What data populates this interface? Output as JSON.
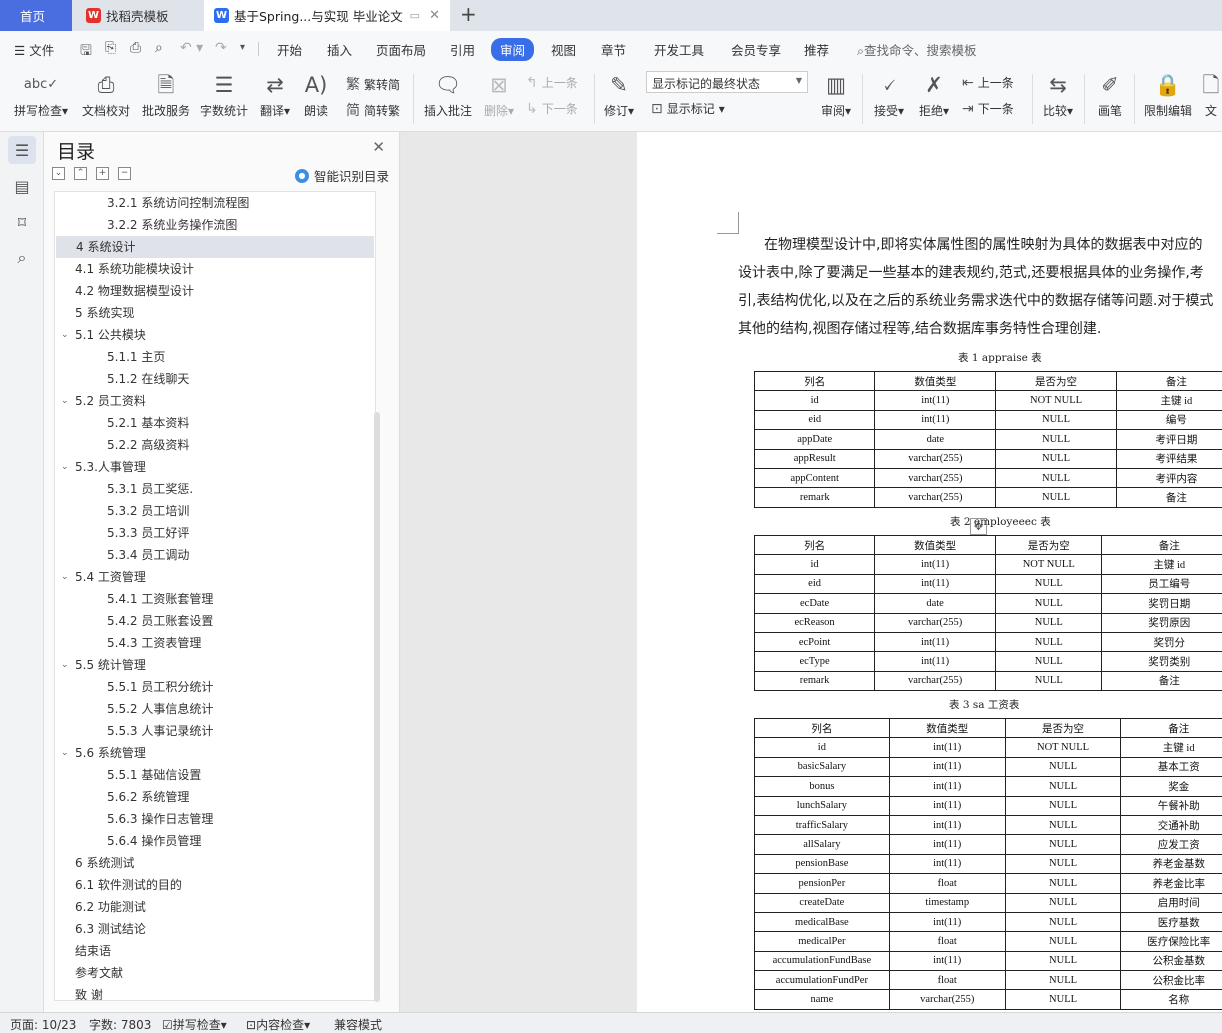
{
  "tabs": {
    "home": "首页",
    "wps": "找稻壳模板",
    "doc": "基于Spring...与实现 毕业论文"
  },
  "menu": {
    "file": "文件",
    "items": [
      "开始",
      "插入",
      "页面布局",
      "引用",
      "审阅",
      "视图",
      "章节",
      "开发工具",
      "会员专享",
      "推荐"
    ],
    "active": "审阅",
    "search": "查找命令、搜索模板"
  },
  "ribbon": {
    "spell": "拼写检查",
    "doccheck": "文档校对",
    "batch": "批改服务",
    "wordcount": "字数统计",
    "translate": "翻译",
    "read": "朗读",
    "trad": "繁转简",
    "simp": "简转繁",
    "insert_comment": "插入批注",
    "delete": "删除",
    "prev1": "上一条",
    "next1": "下一条",
    "track": "修订",
    "display_mode": "显示标记的最终状态",
    "show_marks": "显示标记",
    "review": "审阅",
    "accept": "接受",
    "reject": "拒绝",
    "prev2": "上一条",
    "next2": "下一条",
    "compare": "比较",
    "pen": "画笔",
    "restrict": "限制编辑",
    "doc_partial": "文"
  },
  "toc": {
    "title": "目录",
    "smart": "智能识别目录",
    "items": [
      {
        "label": "3.2.1 系统访问控制流程图",
        "level": 3
      },
      {
        "label": "3.2.2 系统业务操作流图",
        "level": 3
      },
      {
        "label": "4 系统设计",
        "level": 1,
        "selected": true
      },
      {
        "label": "4.1 系统功能模块设计",
        "level": 1
      },
      {
        "label": "4.2 物理数据模型设计",
        "level": 1
      },
      {
        "label": "5 系统实现",
        "level": 1
      },
      {
        "label": "5.1  公共模块",
        "level": 1,
        "expand": true
      },
      {
        "label": "5.1.1 主页",
        "level": 3
      },
      {
        "label": "5.1.2 在线聊天",
        "level": 3
      },
      {
        "label": "5.2  员工资料",
        "level": 1,
        "expand": true
      },
      {
        "label": "5.2.1 基本资料",
        "level": 3
      },
      {
        "label": "5.2.2  高级资料",
        "level": 3
      },
      {
        "label": "5.3.人事管理",
        "level": 1,
        "expand": true
      },
      {
        "label": "5.3.1 员工奖惩.",
        "level": 3
      },
      {
        "label": "5.3.2 员工培训",
        "level": 3
      },
      {
        "label": "5.3.3 员工好评",
        "level": 3
      },
      {
        "label": "5.3.4 员工调动",
        "level": 3
      },
      {
        "label": "5.4 工资管理",
        "level": 1,
        "expand": true
      },
      {
        "label": "5.4.1 工资账套管理",
        "level": 3
      },
      {
        "label": "5.4.2 员工账套设置",
        "level": 3
      },
      {
        "label": "5.4.3 工资表管理",
        "level": 3
      },
      {
        "label": "5.5 统计管理",
        "level": 1,
        "expand": true
      },
      {
        "label": "5.5.1 员工积分统计",
        "level": 3
      },
      {
        "label": "5.5.2 人事信息统计",
        "level": 3
      },
      {
        "label": "5.5.3 人事记录统计",
        "level": 3
      },
      {
        "label": "5.6 系统管理",
        "level": 1,
        "expand": true
      },
      {
        "label": "5.5.1 基础信设置",
        "level": 3
      },
      {
        "label": "5.6.2 系统管理",
        "level": 3
      },
      {
        "label": "5.6.3 操作日志管理",
        "level": 3
      },
      {
        "label": "5.6.4 操作员管理",
        "level": 3
      },
      {
        "label": "6 系统测试",
        "level": 1
      },
      {
        "label": "6.1  软件测试的目的",
        "level": 1
      },
      {
        "label": "6.2  功能测试",
        "level": 1
      },
      {
        "label": "6.3  测试结论",
        "level": 1
      },
      {
        "label": "结束语",
        "level": 1
      },
      {
        "label": "参考文献",
        "level": 1
      },
      {
        "label": "致    谢",
        "level": 1
      }
    ]
  },
  "doc": {
    "para_lines": [
      "在物理模型设计中,即将实体属性图的属性映射为具体的数据表中对应的",
      "设计表中,除了要满足一些基本的建表规约,范式,还要根据具体的业务操作,考",
      "引,表结构优化,以及在之后的系统业务需求迭代中的数据存储等问题.对于模式",
      "其他的结构,视图存储过程等,结合数据库事务特性合理创建."
    ],
    "table1": {
      "caption": "表 1    appraise 表",
      "rows": [
        [
          "列名",
          "数值类型",
          "是否为空",
          "备注"
        ],
        [
          "id",
          "int(11)",
          "NOT NULL",
          "主键 id"
        ],
        [
          "eid",
          "int(11)",
          "NULL",
          "编号"
        ],
        [
          "appDate",
          "date",
          "NULL",
          "考评日期"
        ],
        [
          "appResult",
          "varchar(255)",
          "NULL",
          "考评结果"
        ],
        [
          "appContent",
          "varchar(255)",
          "NULL",
          "考评内容"
        ],
        [
          "remark",
          "varchar(255)",
          "NULL",
          "备注"
        ]
      ]
    },
    "table2": {
      "caption": "表 2    employeeec 表",
      "rows": [
        [
          "列名",
          "数值类型",
          "是否为空",
          "备注"
        ],
        [
          "id",
          "int(11)",
          "NOT NULL",
          "主键 id"
        ],
        [
          "eid",
          "int(11)",
          "NULL",
          "员工编号"
        ],
        [
          "ecDate",
          "date",
          "NULL",
          "奖罚日期"
        ],
        [
          "ecReason",
          "varchar(255)",
          "NULL",
          "奖罚原因"
        ],
        [
          "ecPoint",
          "int(11)",
          "NULL",
          "奖罚分"
        ],
        [
          "ecType",
          "int(11)",
          "NULL",
          "奖罚类别"
        ],
        [
          "remark",
          "varchar(255)",
          "NULL",
          "备注"
        ]
      ]
    },
    "table3": {
      "caption": "表 3    sa        工资表",
      "rows": [
        [
          "列名",
          "数值类型",
          "是否为空",
          "备注"
        ],
        [
          "id",
          "int(11)",
          "NOT NULL",
          "主键 id"
        ],
        [
          "basicSalary",
          "int(11)",
          "NULL",
          "基本工资"
        ],
        [
          "bonus",
          "int(11)",
          "NULL",
          "奖金"
        ],
        [
          "lunchSalary",
          "int(11)",
          "NULL",
          "午餐补助"
        ],
        [
          "trafficSalary",
          "int(11)",
          "NULL",
          "交通补助"
        ],
        [
          "allSalary",
          "int(11)",
          "NULL",
          "应发工资"
        ],
        [
          "pensionBase",
          "int(11)",
          "NULL",
          "养老金基数"
        ],
        [
          "pensionPer",
          "float",
          "NULL",
          "养老金比率"
        ],
        [
          "createDate",
          "timestamp",
          "NULL",
          "启用时间"
        ],
        [
          "medicalBase",
          "int(11)",
          "NULL",
          "医疗基数"
        ],
        [
          "medicalPer",
          "float",
          "NULL",
          "医疗保险比率"
        ],
        [
          "accumulationFundBase",
          "int(11)",
          "NULL",
          "公积金基数"
        ],
        [
          "accumulationFundPer",
          "float",
          "NULL",
          "公积金比率"
        ],
        [
          "name",
          "varchar(255)",
          "NULL",
          "名称"
        ]
      ]
    }
  },
  "status": {
    "page": "页面: 10/23",
    "words": "字数: 7803",
    "spell": "拼写检查",
    "content": "内容检查",
    "compat": "兼容模式"
  },
  "colors": {
    "accent": "#3a6ee8",
    "home_tab": "#4a6ee0",
    "selected_row": "#dfe2e8"
  }
}
